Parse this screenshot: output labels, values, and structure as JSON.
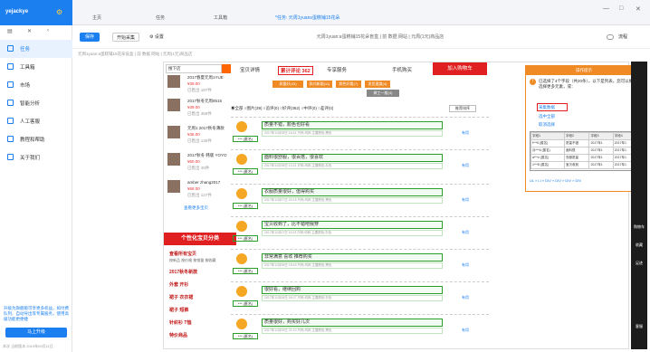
{
  "sidebar": {
    "brand": "yejackye",
    "items": [
      {
        "label": "任务"
      },
      {
        "label": "工具箱"
      },
      {
        "label": "市场"
      },
      {
        "label": "智能分析"
      },
      {
        "label": "人工客服"
      },
      {
        "label": "教程和帮助"
      },
      {
        "label": "关于我们"
      }
    ],
    "promo": "升级为旗舰版可享更多权益，如付费队列、自动导出等专属服务，使用高级功能更便捷",
    "upgrade": "马上升级",
    "version": "本次 当前版本 2019年09月11日"
  },
  "tabs": [
    {
      "label": "主页"
    },
    {
      "label": "任务"
    },
    {
      "label": "工具箱"
    },
    {
      "label": "*任务: 元周1yuans蛋糕铺15花朵"
    }
  ],
  "toolbar": {
    "save": "保存",
    "start": "开始采集",
    "settings": "设置",
    "url": "元周1yuan:a蛋糕铺15花朵盲盒 | 前 数据 网站 | 元周(1元)商品店",
    "reader": "流程"
  },
  "hint": "元周1yuan:a蛋糕铺15花朵盲盒 | 前 数据 网站 | 元周(1元)商品店",
  "page": {
    "search_placeholder": "搜下店",
    "nav": [
      "宝贝详情",
      "累计评论 362",
      "专享服务",
      "手机购买"
    ],
    "cart": "加入购物车",
    "tags": [
      "质量好(43)",
      "款式新颖(11)",
      "颜色好看(7)",
      "发货速度(4)",
      "做工一般(3)"
    ],
    "filters": "◉全部  ○图片(39)  ○追评(0)  ○好评(362)  ○中评(0)  ○差评(0)",
    "sort": "推荐排序"
  },
  "products": [
    {
      "title": "2017春夏元周1YUE",
      "price": "¥39.00",
      "sales": "已售出 187件"
    },
    {
      "title": "2017秋冬元周8515",
      "price": "¥39.00",
      "sales": "已售出 358件"
    },
    {
      "title": "元周1 2017秋冬薄款",
      "price": "¥36.00",
      "sales": "已售出 136件"
    },
    {
      "title": "2017秋冬 韩版 YOYO",
      "price": "¥50.00",
      "sales": "已售出 45件"
    },
    {
      "title": "amber zhang2017",
      "price": "¥68.00",
      "sales": "已售出 127件"
    }
  ],
  "more_link": "查看更多宝贝",
  "categories": {
    "title": "个性化宝贝分类",
    "items": [
      {
        "label": "查看所有宝贝",
        "sub": "按新品  按价格  按销量  按收藏"
      },
      {
        "label": "2017秋冬新款",
        "sub": ""
      },
      {
        "label": "外套 开衫",
        "sub": ""
      },
      {
        "label": "裙子 衣衣裙",
        "sub": ""
      },
      {
        "label": "裙子 短裤",
        "sub": ""
      },
      {
        "label": "针织衫 T恤",
        "sub": ""
      },
      {
        "label": "特价商品",
        "sub": ""
      }
    ]
  },
  "reviews": [
    {
      "user": "*** (匿名)",
      "text": "质量不错，颜色也好看",
      "meta": "2017年11月08日 16:41  尺码:均码  主要颜色:黑色",
      "use": "有用"
    },
    {
      "user": "*** (匿名)",
      "text": "面料很舒服，很百搭，很喜欢",
      "meta": "2017年11月08日 10:21  尺码:均码  主要颜色:灰色",
      "use": "有用"
    },
    {
      "user": "*** (匿名)",
      "text": "衣服质量很好，值得购买",
      "meta": "2017年11月07日 20:15  尺码:均码  主要颜色:黑色",
      "use": "有用"
    },
    {
      "user": "*** (匿名)",
      "text": "宝贝收到了，比不错吧我穿",
      "meta": "2017年11月07日 11:02  尺码:均码  主要颜色:灰色",
      "use": "有用"
    },
    {
      "user": "*** (匿名)",
      "text": "非常满意 喜欢 推荐购买",
      "meta": "2017年11月06日 18:43  尺码:均码  主要颜色:黑色",
      "use": "有用"
    },
    {
      "user": "*** (匿名)",
      "text": "很好看，继续回购",
      "meta": "2017年11月06日 09:27  尺码:均码  主要颜色:灰色",
      "use": "有用"
    },
    {
      "user": "*** (匿名)",
      "text": "质量很好，购买好几次",
      "meta": "2017年11月05日 21:10  尺码:均码  主要颜色:黑色",
      "use": "有用"
    }
  ],
  "panel": {
    "title": "操作提示",
    "message": "已选择了4个字段（共20条），以下是列表，您可以继续选择更多元素，或：",
    "collect": "采集数据",
    "select_all": "选中全部",
    "cancel": "取消选择",
    "columns": [
      "字段1",
      "字段2",
      "字段3",
      "字段4"
    ],
    "rows": [
      [
        "f***6 (匿名)",
        "质量不错",
        "2017年1",
        "2017年1"
      ],
      [
        "泳***6 (匿名)",
        "面料很",
        "2017年1",
        "2017年1"
      ],
      [
        "a***n (匿名)",
        "衣服质量",
        "2017年1",
        "2017年1"
      ],
      [
        "1***8 (匿名)",
        "宝贝收到",
        "2017年1",
        "2017年1"
      ]
    ],
    "breadcrumb": "UL » LI » DIV » DIV » DIV » DIV"
  },
  "right_strip": [
    "购物车",
    "收藏",
    "足迹",
    "客服"
  ]
}
